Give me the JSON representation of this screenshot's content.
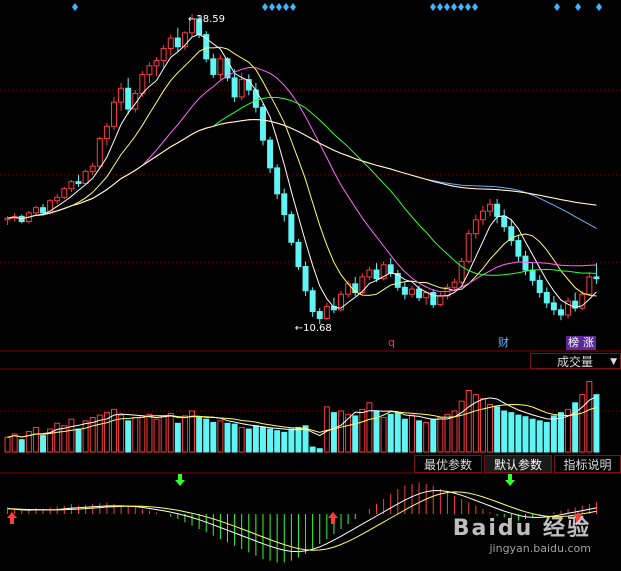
{
  "price_panel": {
    "high_label": "28.59",
    "low_label": "10.68",
    "event_markers": [
      "q",
      "财",
      "榜",
      "涨"
    ]
  },
  "volume_panel": {
    "indicator_select": "成交量",
    "buttons": [
      "最优参数",
      "默认参数",
      "指标说明"
    ],
    "active_button": 1
  },
  "watermark": {
    "line1": "Baidu 经验",
    "line2": "jingyan.baidu.com"
  },
  "colors": {
    "up": "#ff3b3b",
    "down": "#5ff5f5",
    "ma5": "#ffffff",
    "ma10": "#ffff66",
    "ma20": "#ff66ff",
    "ma30": "#33ff33",
    "ma60": "#66b3ff",
    "ma120": "#ff4040",
    "ma250": "#ffffcc",
    "grid": "#8b0000"
  },
  "chart_data": {
    "type": "candlestick",
    "price_high": 28.59,
    "price_low": 10.68,
    "candles": [
      [
        16.7,
        16.9,
        16.4,
        16.8
      ],
      [
        16.8,
        17.1,
        16.6,
        16.9
      ],
      [
        16.9,
        17.0,
        16.5,
        16.6
      ],
      [
        16.6,
        17.2,
        16.5,
        17.1
      ],
      [
        17.1,
        17.5,
        17.0,
        17.4
      ],
      [
        17.4,
        17.6,
        17.0,
        17.1
      ],
      [
        17.1,
        17.9,
        17.0,
        17.8
      ],
      [
        17.8,
        18.2,
        17.6,
        18.0
      ],
      [
        18.0,
        18.6,
        17.9,
        18.5
      ],
      [
        18.5,
        19.0,
        18.3,
        18.9
      ],
      [
        18.9,
        19.3,
        18.6,
        18.8
      ],
      [
        18.8,
        19.6,
        18.7,
        19.5
      ],
      [
        19.5,
        20.0,
        19.3,
        19.8
      ],
      [
        19.8,
        21.5,
        19.7,
        21.4
      ],
      [
        21.4,
        22.3,
        21.0,
        22.1
      ],
      [
        22.1,
        23.8,
        21.9,
        23.5
      ],
      [
        23.5,
        24.6,
        23.0,
        24.3
      ],
      [
        24.3,
        24.9,
        22.8,
        23.1
      ],
      [
        23.1,
        24.2,
        22.9,
        24.0
      ],
      [
        24.0,
        25.3,
        23.8,
        25.1
      ],
      [
        25.1,
        25.8,
        24.6,
        25.6
      ],
      [
        25.6,
        26.1,
        25.0,
        25.9
      ],
      [
        25.9,
        26.8,
        25.5,
        26.6
      ],
      [
        26.6,
        27.4,
        26.2,
        27.2
      ],
      [
        27.2,
        27.8,
        26.4,
        26.7
      ],
      [
        26.7,
        27.6,
        26.5,
        27.5
      ],
      [
        27.5,
        28.59,
        27.3,
        28.3
      ],
      [
        28.3,
        28.5,
        27.2,
        27.4
      ],
      [
        27.4,
        27.6,
        25.8,
        26.0
      ],
      [
        26.0,
        26.3,
        24.9,
        25.1
      ],
      [
        25.1,
        26.2,
        24.8,
        26.0
      ],
      [
        26.0,
        26.1,
        24.7,
        24.9
      ],
      [
        24.9,
        25.4,
        23.5,
        23.8
      ],
      [
        23.8,
        25.2,
        23.6,
        24.8
      ],
      [
        24.8,
        25.1,
        23.9,
        24.2
      ],
      [
        24.2,
        24.6,
        22.9,
        23.2
      ],
      [
        23.2,
        23.4,
        21.0,
        21.3
      ],
      [
        21.3,
        21.5,
        19.4,
        19.7
      ],
      [
        19.7,
        19.9,
        17.9,
        18.2
      ],
      [
        18.2,
        18.5,
        16.6,
        17.0
      ],
      [
        17.0,
        17.2,
        15.2,
        15.4
      ],
      [
        15.4,
        15.6,
        13.8,
        14.0
      ],
      [
        14.0,
        14.3,
        12.3,
        12.6
      ],
      [
        12.6,
        12.8,
        11.1,
        11.4
      ],
      [
        11.4,
        11.6,
        10.68,
        11.0
      ],
      [
        11.0,
        11.9,
        10.9,
        11.7
      ],
      [
        11.7,
        12.2,
        11.3,
        11.5
      ],
      [
        11.5,
        12.6,
        11.4,
        12.4
      ],
      [
        12.4,
        13.2,
        12.2,
        13.0
      ],
      [
        13.0,
        13.4,
        12.3,
        12.5
      ],
      [
        12.5,
        13.6,
        12.4,
        13.4
      ],
      [
        13.4,
        14.0,
        13.2,
        13.8
      ],
      [
        13.8,
        14.2,
        13.1,
        13.3
      ],
      [
        13.3,
        14.3,
        13.2,
        14.1
      ],
      [
        14.1,
        14.5,
        13.4,
        13.6
      ],
      [
        13.6,
        13.8,
        12.6,
        12.8
      ],
      [
        12.8,
        13.1,
        12.1,
        12.4
      ],
      [
        12.4,
        12.9,
        12.2,
        12.7
      ],
      [
        12.7,
        12.9,
        12.0,
        12.2
      ],
      [
        12.2,
        12.6,
        11.8,
        12.5
      ],
      [
        12.5,
        12.7,
        11.6,
        11.8
      ],
      [
        11.8,
        12.5,
        11.7,
        12.3
      ],
      [
        12.3,
        13.0,
        12.1,
        12.8
      ],
      [
        12.8,
        13.3,
        12.6,
        13.1
      ],
      [
        13.1,
        14.5,
        13.0,
        14.3
      ],
      [
        14.3,
        16.1,
        14.2,
        15.9
      ],
      [
        15.9,
        17.0,
        15.6,
        16.7
      ],
      [
        16.7,
        17.5,
        16.4,
        17.2
      ],
      [
        17.2,
        17.9,
        16.9,
        17.6
      ],
      [
        17.6,
        17.9,
        16.5,
        16.9
      ],
      [
        16.9,
        17.3,
        16.0,
        16.3
      ],
      [
        16.3,
        16.7,
        15.2,
        15.5
      ],
      [
        15.5,
        15.8,
        14.3,
        14.6
      ],
      [
        14.6,
        14.9,
        13.5,
        13.8
      ],
      [
        13.8,
        14.2,
        12.9,
        13.2
      ],
      [
        13.2,
        13.5,
        12.2,
        12.5
      ],
      [
        12.5,
        12.8,
        11.6,
        11.9
      ],
      [
        11.9,
        12.3,
        11.2,
        11.5
      ],
      [
        11.5,
        11.8,
        10.9,
        11.2
      ],
      [
        11.2,
        12.2,
        11.0,
        12.0
      ],
      [
        12.0,
        12.5,
        11.4,
        11.6
      ],
      [
        11.6,
        12.6,
        11.5,
        12.4
      ],
      [
        12.4,
        13.6,
        12.3,
        13.4
      ],
      [
        13.4,
        14.2,
        13.0,
        13.3
      ]
    ],
    "volume_ylim": [
      0,
      100
    ],
    "volume": [
      18,
      22,
      15,
      25,
      30,
      20,
      28,
      35,
      32,
      40,
      28,
      38,
      42,
      45,
      48,
      52,
      45,
      38,
      42,
      44,
      46,
      40,
      43,
      47,
      35,
      44,
      50,
      42,
      40,
      36,
      38,
      35,
      34,
      30,
      28,
      32,
      30,
      28,
      26,
      24,
      28,
      30,
      32,
      6,
      4,
      55,
      48,
      50,
      46,
      44,
      52,
      60,
      50,
      42,
      46,
      48,
      40,
      45,
      38,
      36,
      40,
      42,
      46,
      50,
      62,
      75,
      70,
      65,
      58,
      55,
      50,
      48,
      45,
      43,
      40,
      38,
      36,
      44,
      48,
      52,
      60,
      70,
      86,
      70
    ],
    "macd": [
      8,
      6,
      4,
      5,
      7,
      6,
      8,
      9,
      10,
      12,
      10,
      11,
      12,
      13,
      14,
      12,
      10,
      9,
      8,
      6,
      4,
      2,
      0,
      -3,
      -6,
      -10,
      -14,
      -18,
      -22,
      -26,
      -30,
      -34,
      -38,
      -42,
      -46,
      -50,
      -54,
      -56,
      -58,
      -58,
      -56,
      -52,
      -48,
      -42,
      -36,
      -30,
      -24,
      -18,
      -12,
      -6,
      0,
      6,
      12,
      18,
      24,
      30,
      34,
      36,
      38,
      36,
      34,
      30,
      26,
      22,
      18,
      14,
      10,
      6,
      2,
      -2,
      -4,
      -6,
      -8,
      -6,
      -4,
      -2,
      0,
      2,
      4,
      6,
      8,
      10,
      12,
      14
    ]
  }
}
